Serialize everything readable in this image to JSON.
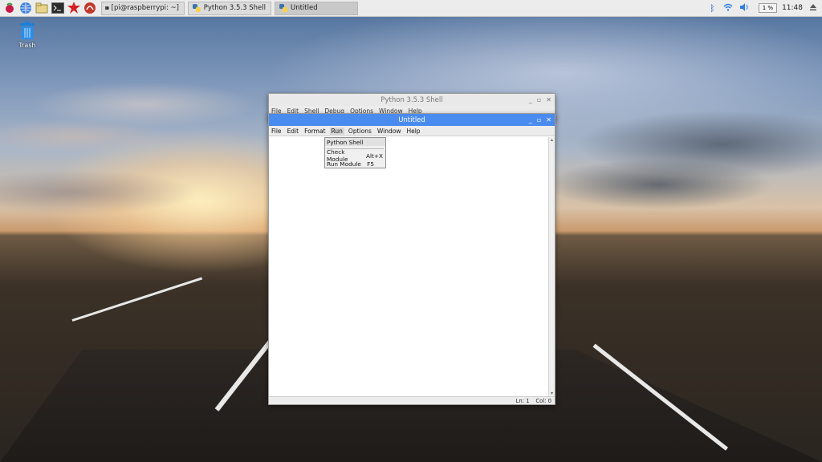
{
  "taskbar": {
    "apps": [
      {
        "name": "raspberry-menu-icon"
      },
      {
        "name": "web-browser-icon"
      },
      {
        "name": "file-manager-icon"
      },
      {
        "name": "terminal-icon"
      },
      {
        "name": "mathematica-icon"
      },
      {
        "name": "wolfram-icon"
      }
    ],
    "tasks": [
      {
        "label": "[pi@raspberrypi: ~]",
        "icon": "terminal-icon"
      },
      {
        "label": "Python 3.5.3 Shell",
        "icon": "python-icon"
      },
      {
        "label": "Untitled",
        "icon": "python-icon"
      }
    ],
    "tray": {
      "cpu": "1 %",
      "clock": "11:48",
      "icons": [
        "bluetooth-icon",
        "wifi-icon",
        "volume-icon",
        "eject-icon"
      ]
    }
  },
  "desktop": {
    "trash_label": "Trash"
  },
  "shell_window": {
    "title": "Python 3.5.3 Shell",
    "menus": [
      "File",
      "Edit",
      "Shell",
      "Debug",
      "Options",
      "Window",
      "Help"
    ]
  },
  "editor_window": {
    "title": "Untitled",
    "menus": [
      "File",
      "Edit",
      "Format",
      "Run",
      "Options",
      "Window",
      "Help"
    ],
    "status": {
      "ln": "Ln: 1",
      "col": "Col: 0"
    }
  },
  "run_menu": {
    "items": [
      {
        "label": "Python Shell",
        "shortcut": ""
      },
      {
        "label": "Check Module",
        "shortcut": "Alt+X"
      },
      {
        "label": "Run Module",
        "shortcut": "F5"
      }
    ]
  },
  "colors": {
    "accent": "#4a8bf0",
    "taskbar_bg": "#ececec",
    "editor_active_title": "#4a8bf0",
    "shell_title": "#e9e9e9"
  }
}
